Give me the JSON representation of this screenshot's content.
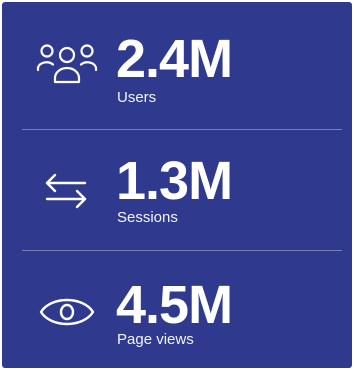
{
  "stats": [
    {
      "icon": "users-icon",
      "value": "2.4M",
      "label": "Users"
    },
    {
      "icon": "swap-arrows-icon",
      "value": "1.3M",
      "label": "Sessions"
    },
    {
      "icon": "eye-icon",
      "value": "4.5M",
      "label": "Page views"
    }
  ],
  "colors": {
    "background": "#2f3a8f",
    "text": "#ffffff",
    "divider": "rgba(255,255,255,0.35)"
  }
}
